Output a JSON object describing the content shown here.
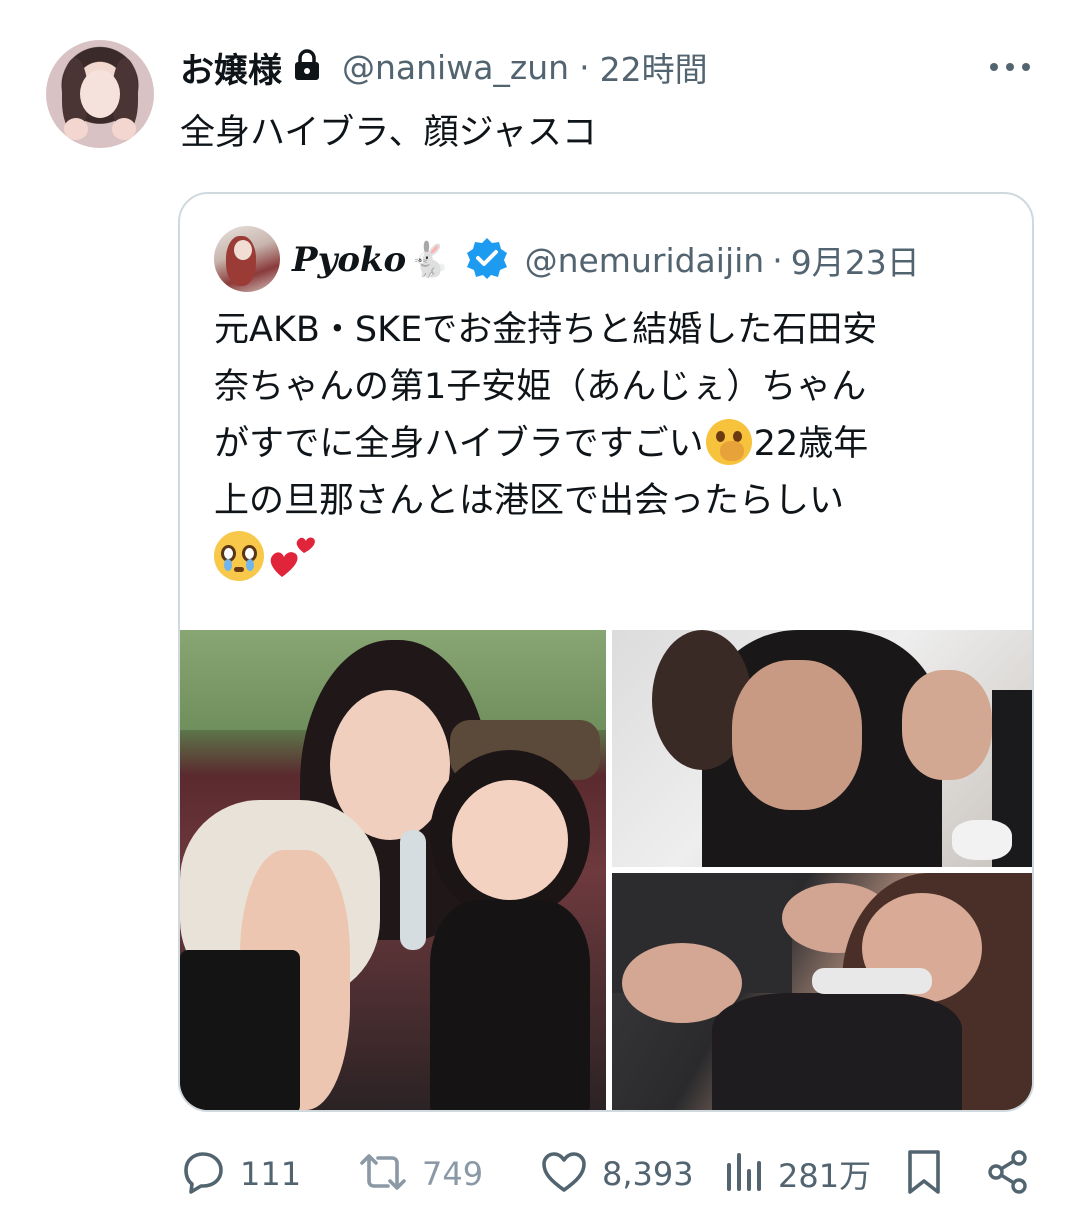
{
  "tweet": {
    "author_name": "お嬢様",
    "handle": "@naniwa_zun",
    "separator": "·",
    "time": "22時間",
    "text": "全身ハイブラ、顔ジャスコ"
  },
  "quoted_tweet": {
    "author_name": "Pyoko",
    "author_emoji": "🐇",
    "handle": "@nemuridaijin",
    "separator": "·",
    "date": "9月23日",
    "text_lines": [
      "元AKB・SKEでお金持ちと結婚した石田安",
      "奈ちゃんの第1子安姫（あんじぇ）ちゃん",
      "がすでに全身ハイブラですごい",
      "22歳年",
      "上の旦那さんとは港区で出会ったらしい"
    ]
  },
  "actions": {
    "replies": "111",
    "retweets": "749",
    "likes": "8,393",
    "views": "281万"
  },
  "icons": {
    "lock": "lock-icon",
    "more": "more-icon",
    "verified": "verified-badge-icon",
    "reply": "reply-icon",
    "retweet": "retweet-icon",
    "like": "heart-icon",
    "views": "views-icon",
    "bookmark": "bookmark-icon",
    "share": "share-icon"
  },
  "colors": {
    "text": "#0f1419",
    "secondary": "#536471",
    "verified": "#1d9bf0",
    "border": "#cfd9de"
  }
}
